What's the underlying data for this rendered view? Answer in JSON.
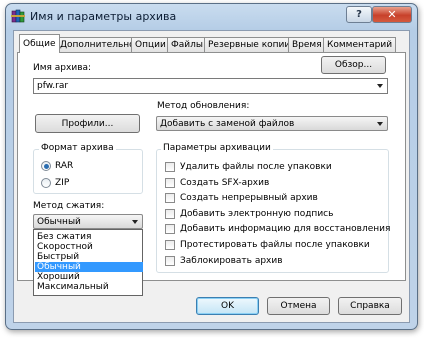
{
  "window": {
    "title": "Имя и параметры архива",
    "help_label": "?",
    "close_label": "✕",
    "icon": "winrar-books-icon"
  },
  "tabs": [
    {
      "label": "Общие",
      "active": true
    },
    {
      "label": "Дополнительно",
      "active": false
    },
    {
      "label": "Опции",
      "active": false
    },
    {
      "label": "Файлы",
      "active": false
    },
    {
      "label": "Резервные копии",
      "active": false
    },
    {
      "label": "Время",
      "active": false
    },
    {
      "label": "Комментарий",
      "active": false
    }
  ],
  "general": {
    "archive_name_label": "Имя архива:",
    "browse_label": "Обзор...",
    "archive_name_value": "pfw.rar",
    "update_method_label": "Метод обновления:",
    "profiles_label": "Профили...",
    "update_method_value": "Добавить с заменой файлов",
    "format_group_label": "Формат архива",
    "format_options": [
      {
        "label": "RAR",
        "selected": true
      },
      {
        "label": "ZIP",
        "selected": false
      }
    ],
    "compression_label": "Метод сжатия:",
    "compression_value": "Обычный",
    "compression_options": [
      {
        "label": "Без сжатия",
        "selected": false
      },
      {
        "label": "Скоростной",
        "selected": false
      },
      {
        "label": "Быстрый",
        "selected": false
      },
      {
        "label": "Обычный",
        "selected": true
      },
      {
        "label": "Хороший",
        "selected": false
      },
      {
        "label": "Максимальный",
        "selected": false
      }
    ],
    "options_group_label": "Параметры архивации",
    "options": [
      {
        "label": "Удалить файлы после упаковки",
        "checked": false
      },
      {
        "label": "Создать SFX-архив",
        "checked": false
      },
      {
        "label": "Создать непрерывный архив",
        "checked": false
      },
      {
        "label": "Добавить электронную подпись",
        "checked": false
      },
      {
        "label": "Добавить информацию для восстановления",
        "checked": false
      },
      {
        "label": "Протестировать файлы после упаковки",
        "checked": false
      },
      {
        "label": "Заблокировать архив",
        "checked": false
      }
    ]
  },
  "buttons": {
    "ok": "OK",
    "cancel": "Отмена",
    "help": "Справка"
  }
}
